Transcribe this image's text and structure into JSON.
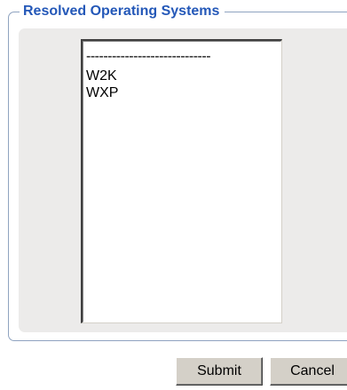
{
  "fieldset": {
    "legend": "Resolved Operating Systems"
  },
  "listbox": {
    "options": [
      {
        "label": "-----------------------------"
      },
      {
        "label": "W2K"
      },
      {
        "label": "WXP"
      }
    ]
  },
  "buttons": {
    "submit_label": "Submit",
    "cancel_label": "Cancel"
  },
  "colors": {
    "legend_text": "#2458b8",
    "panel_background": "#ecebea",
    "fieldset_border": "#8fa3c0",
    "button_face": "#d4d0c8"
  }
}
